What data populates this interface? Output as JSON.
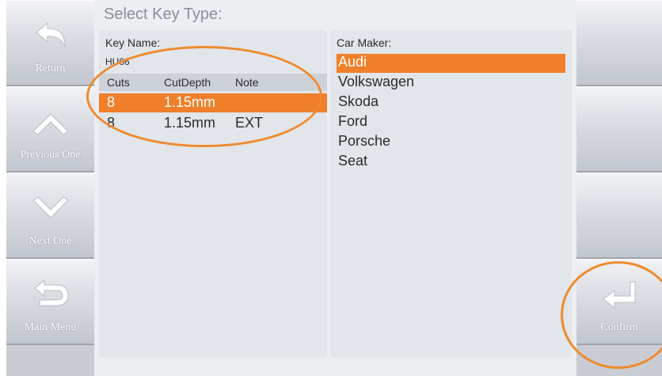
{
  "title": "Select Key Type:",
  "nav_left": [
    {
      "label": "Return",
      "icon": "return-arrow-icon"
    },
    {
      "label": "Previous One",
      "icon": "chevron-up-icon"
    },
    {
      "label": "Next One",
      "icon": "chevron-down-icon"
    },
    {
      "label": "Main Menu",
      "icon": "u-turn-back-icon"
    }
  ],
  "nav_right": {
    "confirm_label": "Confirm",
    "icon": "enter-arrow-icon"
  },
  "key_panel": {
    "name_label": "Key Name:",
    "name_value": "HU66",
    "columns": [
      "Cuts",
      "CutDepth",
      "Note"
    ],
    "rows": [
      {
        "cuts": "8",
        "depth": "1.15mm",
        "note": "",
        "selected": true
      },
      {
        "cuts": "8",
        "depth": "1.15mm",
        "note": "EXT",
        "selected": false
      }
    ]
  },
  "maker_panel": {
    "label": "Car Maker:",
    "items": [
      "Audi",
      "Volkswagen",
      "Skoda",
      "Ford",
      "Porsche",
      "Seat"
    ],
    "selected_index": 0
  },
  "colors": {
    "accent": "#ef7f2a",
    "highlight_ring": "#ef8a2e"
  }
}
